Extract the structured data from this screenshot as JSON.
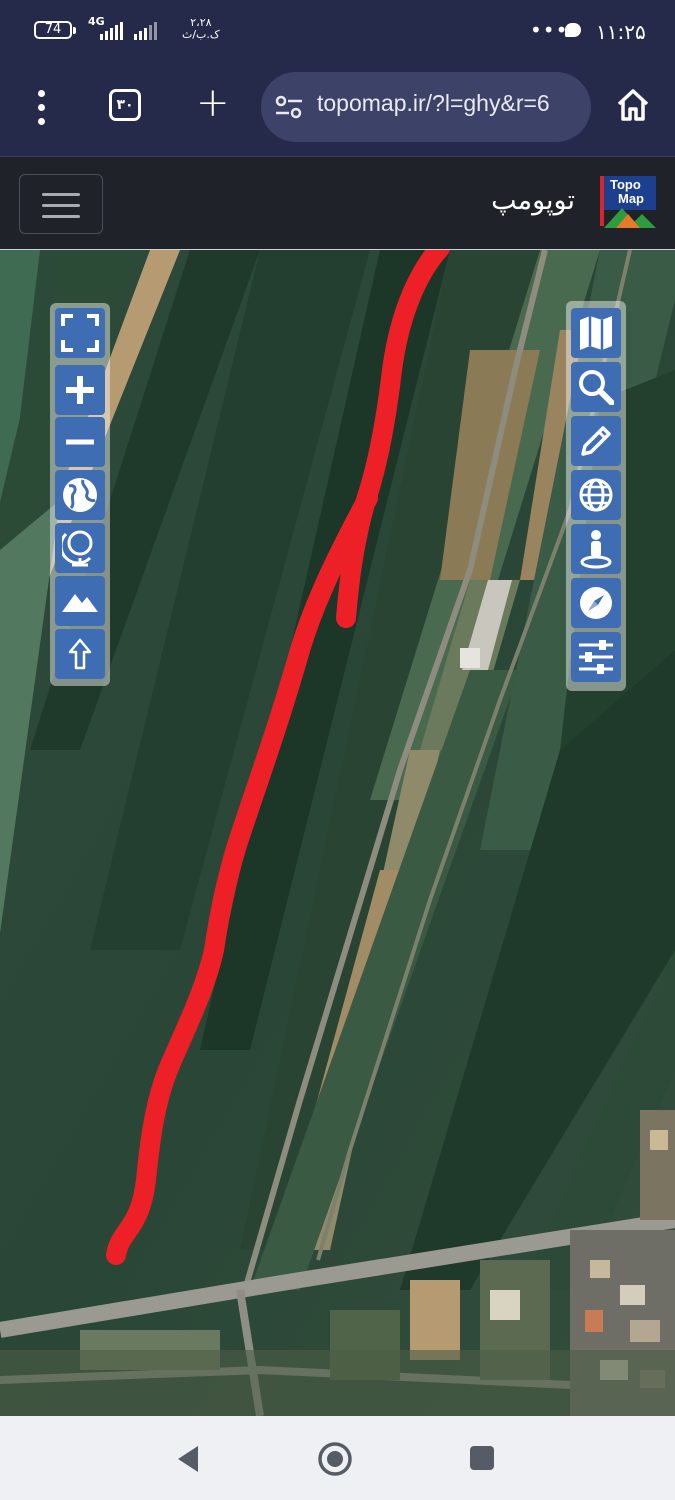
{
  "status_bar": {
    "battery": "74",
    "network": "4G",
    "speed": "۲،۲۸\nک.ب/ث",
    "more": "•••",
    "time": "۱۱:۲۵"
  },
  "browser": {
    "tab_count": "۳۰",
    "new_tab": "+",
    "url": "topomap.ir/?l=ghy&r=6",
    "icons": [
      "more-vert-icon",
      "tab-counter",
      "plus-icon",
      "site-settings-icon",
      "home-icon"
    ]
  },
  "site": {
    "title": "توپومپ",
    "logo_text_1": "Topo",
    "logo_text_2": "Map"
  },
  "map_controls": {
    "left": [
      "fullscreen-icon",
      "zoom-in-icon",
      "zoom-out-icon",
      "globe-icon",
      "desk-globe-icon",
      "terrain-icon",
      "arrow-up-icon"
    ],
    "right": [
      "map-layers-icon",
      "search-icon",
      "pencil-icon",
      "globe-grid-icon",
      "person-location-icon",
      "compass-icon",
      "sliders-icon"
    ]
  },
  "colors": {
    "header_bg": "#1f2329",
    "browser_bg": "#262a4a",
    "control_blue": "#3f6db4",
    "drawn_line": "#ee2027"
  }
}
